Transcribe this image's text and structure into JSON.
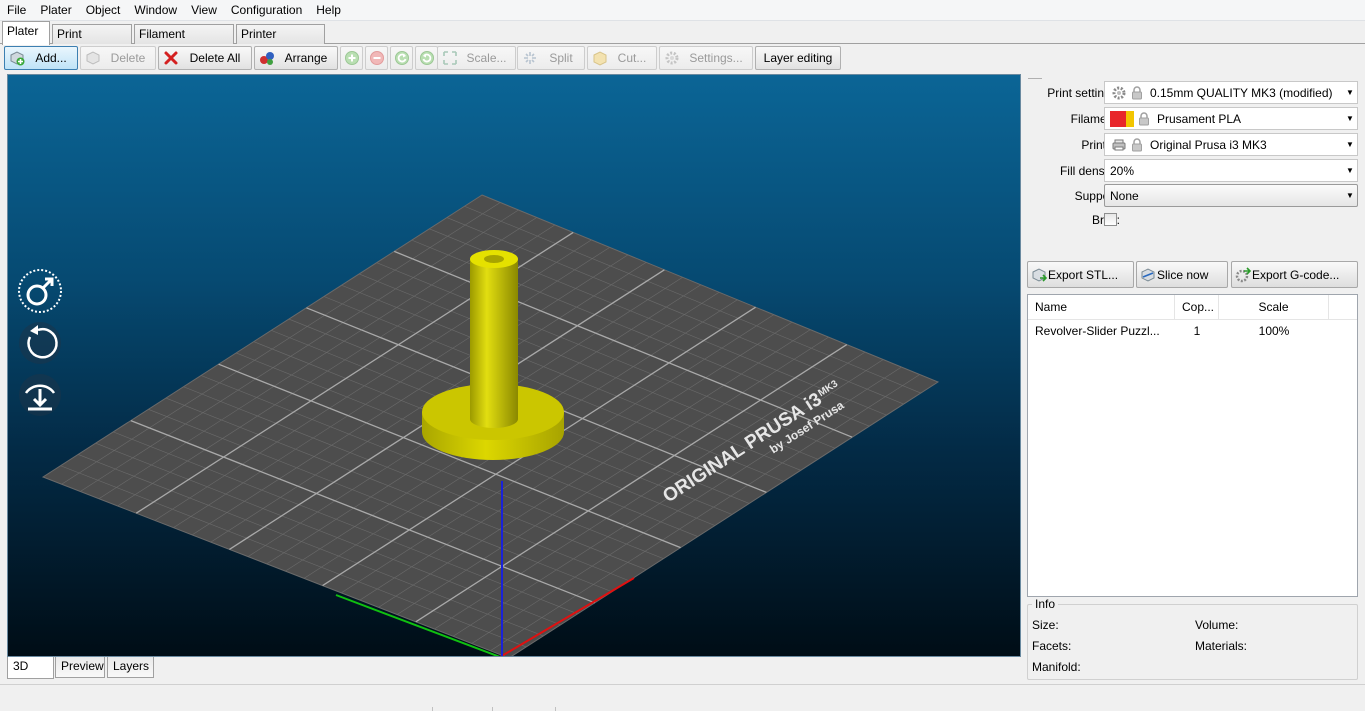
{
  "menu": [
    "File",
    "Plater",
    "Object",
    "Window",
    "View",
    "Configuration",
    "Help"
  ],
  "tabs": [
    "Plater",
    "Print Settings",
    "Filament Settings",
    "Printer Settings"
  ],
  "toolbar": {
    "add": "Add...",
    "delete": "Delete",
    "delete_all": "Delete All",
    "arrange": "Arrange",
    "scale": "Scale...",
    "split": "Split",
    "cut": "Cut...",
    "settings": "Settings...",
    "layer_editing": "Layer editing"
  },
  "bed": {
    "brand_line1": "ORIGINAL PRUSA i3",
    "brand_model": "MK3",
    "brand_line2": "by Josef Prusa"
  },
  "view_tabs": [
    "3D",
    "Preview",
    "Layers"
  ],
  "right": {
    "print_settings_label": "Print settings:",
    "print_settings_value": "0.15mm QUALITY MK3 (modified)",
    "filament_label": "Filament:",
    "filament_value": "Prusament PLA",
    "printer_label": "Printer:",
    "printer_value": "Original Prusa i3 MK3",
    "fill_density_label": "Fill density:",
    "fill_density_value": "20%",
    "support_label": "Support:",
    "support_value": "None",
    "brim_label": "Brim:",
    "brim_checked": false,
    "export_stl": "Export STL...",
    "slice_now": "Slice now",
    "export_gcode": "Export G-code..."
  },
  "objects": {
    "headers": [
      "Name",
      "Cop...",
      "Scale"
    ],
    "rows": [
      {
        "name": "Revolver-Slider Puzzl...",
        "copies": "1",
        "scale": "100%"
      }
    ]
  },
  "info": {
    "title": "Info",
    "size": "Size:",
    "volume": "Volume:",
    "facets": "Facets:",
    "materials": "Materials:",
    "manifold": "Manifold:"
  },
  "colors": {
    "model": "#d8d400",
    "filament_swatch_1": "#e8262a",
    "filament_swatch_2": "#f2c500",
    "axis_x": "#e01010",
    "axis_y": "#10c010",
    "axis_z": "#1020d0"
  }
}
